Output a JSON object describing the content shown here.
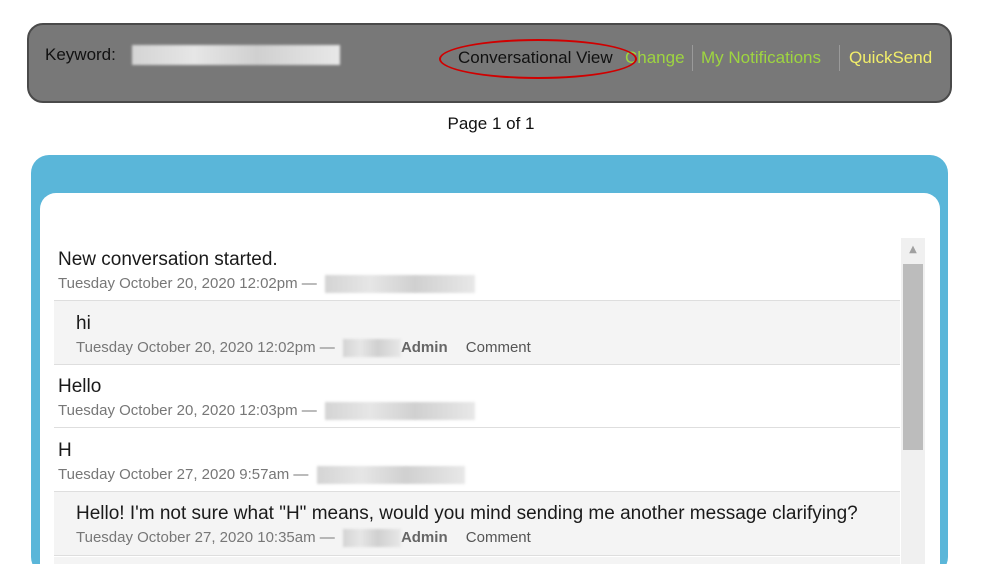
{
  "header": {
    "keyword_label": "Keyword:",
    "nav": {
      "conversational_view": "Conversational View",
      "change": "Change",
      "my_notifications": "My Notifications",
      "quicksend": "QuickSend"
    }
  },
  "pagination": {
    "label": "Page 1 of 1"
  },
  "messages": [
    {
      "text": "New conversation started.",
      "timestamp": "Tuesday October 20, 2020 12:02pm —"
    },
    {
      "text": "hi",
      "timestamp": "Tuesday October 20, 2020 12:02pm —",
      "role": "Admin",
      "comment": "Comment"
    },
    {
      "text": "Hello",
      "timestamp": "Tuesday October 20, 2020 12:03pm —"
    },
    {
      "text": "H",
      "timestamp": "Tuesday October 27, 2020 9:57am —"
    },
    {
      "text": "Hello! I'm not sure what \"H\" means, would you mind sending me another message clarifying?",
      "timestamp": "Tuesday October 27, 2020 10:35am —",
      "role": "Admin",
      "comment": "Comment"
    }
  ],
  "colors": {
    "header_bg": "#787878",
    "panel_accent": "#5ab6d9",
    "link_green": "#9ed540",
    "link_yellow": "#f2ee6a",
    "annotation_red": "#d00000"
  }
}
